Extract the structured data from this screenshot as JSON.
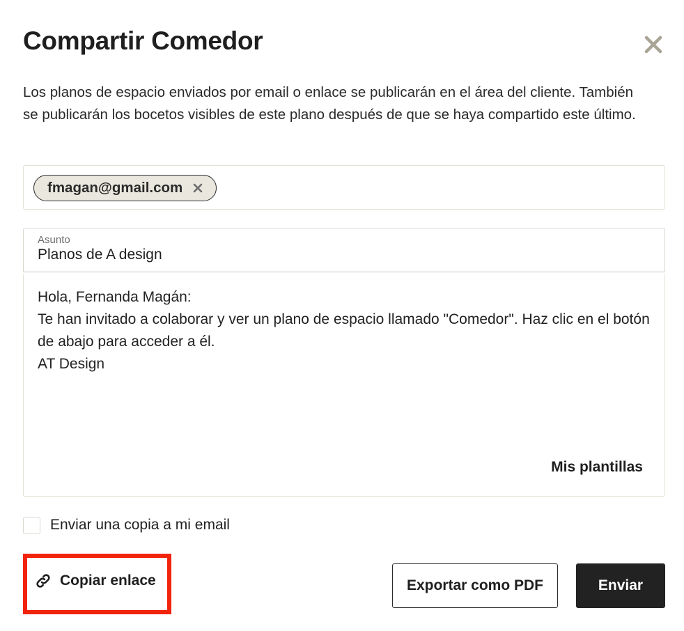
{
  "dialog": {
    "title": "Compartir Comedor",
    "close_icon": "close-icon",
    "description": "Los planos de espacio enviados por email o enlace se publicarán en el área del cliente. También se publicarán los bocetos visibles de este plano después de que se haya compartido este último."
  },
  "recipients": [
    {
      "email": "fmagan@gmail.com",
      "remove_icon": "close-icon"
    }
  ],
  "subject": {
    "label": "Asunto",
    "value": "Planos de A design"
  },
  "message": {
    "lines": [
      "Hola, Fernanda Magán:",
      "Te han invitado a colaborar y ver un plano de espacio llamado \"Comedor\". Haz clic en el botón de abajo para acceder a él.",
      "AT Design"
    ],
    "templates_label": "Mis plantillas"
  },
  "send_copy": {
    "label": "Enviar una copia a mi email",
    "checked": false
  },
  "footer": {
    "copy_link_label": "Copiar enlace",
    "copy_link_icon": "link-icon",
    "export_label": "Exportar como PDF",
    "send_label": "Enviar"
  },
  "colors": {
    "highlight": "#f2230d",
    "primary_button": "#222222",
    "chip_background": "#eae7de",
    "close_icon": "#a8a496"
  }
}
